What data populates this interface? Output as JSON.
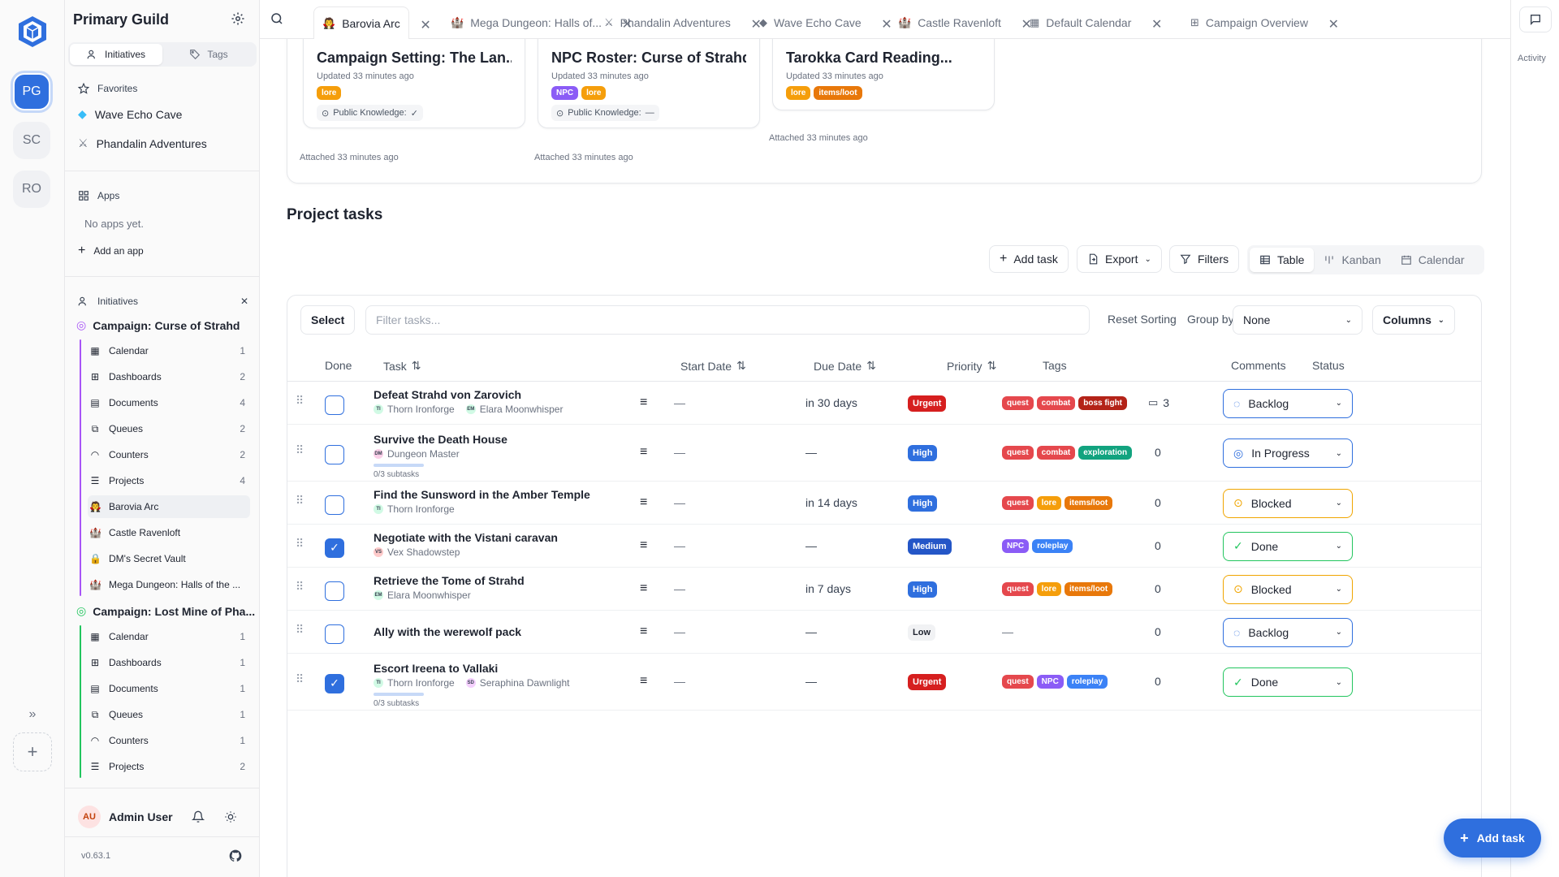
{
  "rail": {
    "workspaces": [
      "PG",
      "SC",
      "RO"
    ]
  },
  "sidebar": {
    "title": "Primary Guild",
    "tabs": [
      "Initiatives",
      "Tags"
    ],
    "favorites_label": "Favorites",
    "favorites": [
      "Wave Echo Cave",
      "Phandalin Adventures"
    ],
    "apps_label": "Apps",
    "apps_empty": "No apps yet.",
    "add_app": "Add an app",
    "initiatives_label": "Initiatives",
    "initiatives": [
      {
        "name": "Campaign: Curse of Strahd",
        "items": [
          {
            "label": "Calendar",
            "count": "1"
          },
          {
            "label": "Dashboards",
            "count": "2"
          },
          {
            "label": "Documents",
            "count": "4"
          },
          {
            "label": "Queues",
            "count": "2"
          },
          {
            "label": "Counters",
            "count": "2"
          },
          {
            "label": "Projects",
            "count": "4"
          },
          {
            "label": "Barovia Arc",
            "count": ""
          },
          {
            "label": "Castle Ravenloft",
            "count": ""
          },
          {
            "label": "DM's Secret Vault",
            "count": ""
          },
          {
            "label": "Mega Dungeon: Halls of the ...",
            "count": ""
          }
        ]
      },
      {
        "name": "Campaign: Lost Mine of Pha...",
        "items": [
          {
            "label": "Calendar",
            "count": "1"
          },
          {
            "label": "Dashboards",
            "count": "1"
          },
          {
            "label": "Documents",
            "count": "1"
          },
          {
            "label": "Queues",
            "count": "1"
          },
          {
            "label": "Counters",
            "count": "1"
          },
          {
            "label": "Projects",
            "count": "2"
          }
        ]
      }
    ],
    "user": {
      "initials": "AU",
      "name": "Admin User"
    },
    "version": "v0.63.1"
  },
  "tabs": [
    {
      "label": "Barovia Arc",
      "active": true
    },
    {
      "label": "Mega Dungeon: Halls of..."
    },
    {
      "label": "Phandalin Adventures"
    },
    {
      "label": "Wave Echo Cave"
    },
    {
      "label": "Castle Ravenloft"
    },
    {
      "label": "Default Calendar"
    },
    {
      "label": "Campaign Overview"
    }
  ],
  "activity_label": "Activity",
  "attachments": [
    {
      "title": "Campaign Setting: The Lan...",
      "updated": "Updated 33 minutes ago",
      "tags": [
        "lore"
      ],
      "public": "Public Knowledge:",
      "public_mark": "✓",
      "attached": "Attached 33 minutes ago"
    },
    {
      "title": "NPC Roster: Curse of Strahd",
      "updated": "Updated 33 minutes ago",
      "tags": [
        "NPC",
        "lore"
      ],
      "public": "Public Knowledge:",
      "public_mark": "—",
      "attached": "Attached 33 minutes ago"
    },
    {
      "title": "Tarokka Card Reading...",
      "updated": "Updated 33 minutes ago",
      "tags": [
        "lore",
        "items/loot"
      ],
      "attached": "Attached 33 minutes ago"
    }
  ],
  "project": {
    "heading": "Project tasks",
    "add_task": "Add task",
    "export": "Export",
    "filters": "Filters",
    "views": [
      "Table",
      "Kanban",
      "Calendar"
    ],
    "select": "Select",
    "filter_placeholder": "Filter tasks...",
    "reset_sorting": "Reset Sorting",
    "group_by": "Group by",
    "group_value": "None",
    "columns": "Columns",
    "headers": [
      "Done",
      "Task",
      "Start Date",
      "Due Date",
      "Priority",
      "Tags",
      "Comments",
      "Status"
    ]
  },
  "tasks": [
    {
      "name": "Defeat Strahd von Zarovich",
      "assignees": [
        {
          "i": "TI",
          "n": "Thorn Ironforge"
        },
        {
          "i": "EM",
          "n": "Elara Moonwhisper"
        }
      ],
      "start": "—",
      "due": "in 30 days",
      "priority": "Urgent",
      "tags": [
        "quest",
        "combat",
        "boss fight"
      ],
      "comments": "3",
      "status": "Backlog",
      "done": false
    },
    {
      "name": "Survive the Death House",
      "assignees": [
        {
          "i": "DM",
          "n": "Dungeon Master"
        }
      ],
      "subtasks": "0/3 subtasks",
      "start": "—",
      "due": "—",
      "priority": "High",
      "tags": [
        "quest",
        "combat",
        "exploration"
      ],
      "comments": "0",
      "status": "In Progress",
      "done": false
    },
    {
      "name": "Find the Sunsword in the Amber Temple",
      "assignees": [
        {
          "i": "TI",
          "n": "Thorn Ironforge"
        }
      ],
      "start": "—",
      "due": "in 14 days",
      "priority": "High",
      "tags": [
        "quest",
        "lore",
        "items/loot"
      ],
      "comments": "0",
      "status": "Blocked",
      "done": false
    },
    {
      "name": "Negotiate with the Vistani caravan",
      "assignees": [
        {
          "i": "VS",
          "n": "Vex Shadowstep"
        }
      ],
      "start": "—",
      "due": "—",
      "priority": "Medium",
      "tags": [
        "NPC",
        "roleplay"
      ],
      "comments": "0",
      "status": "Done",
      "done": true
    },
    {
      "name": "Retrieve the Tome of Strahd",
      "assignees": [
        {
          "i": "EM",
          "n": "Elara Moonwhisper"
        }
      ],
      "start": "—",
      "due": "in 7 days",
      "priority": "High",
      "tags": [
        "quest",
        "lore",
        "items/loot"
      ],
      "comments": "0",
      "status": "Blocked",
      "done": false
    },
    {
      "name": "Ally with the werewolf pack",
      "assignees": [],
      "start": "—",
      "due": "—",
      "priority": "Low",
      "tags": [],
      "tags_empty": "—",
      "comments": "0",
      "status": "Backlog",
      "done": false
    },
    {
      "name": "Escort Ireena to Vallaki",
      "assignees": [
        {
          "i": "TI",
          "n": "Thorn Ironforge"
        },
        {
          "i": "SD",
          "n": "Seraphina Dawnlight"
        }
      ],
      "subtasks": "0/3 subtasks",
      "start": "—",
      "due": "—",
      "priority": "Urgent",
      "tags": [
        "quest",
        "NPC",
        "roleplay"
      ],
      "comments": "0",
      "status": "Done",
      "done": true
    }
  ],
  "fab_label": "Add task",
  "colors": {
    "accent": "#2f6fde",
    "urgent": "#d61f1f",
    "high": "#2f6fde",
    "medium": "#2456c7",
    "low_bg": "#f1f2f4",
    "quest": "#e5484d",
    "combat": "#e5484d",
    "boss fight": "#b42318",
    "exploration": "#12a37f",
    "lore": "#f59e0b",
    "items/loot": "#e8780a",
    "NPC": "#8b5cf6",
    "roleplay": "#3b82f6"
  }
}
